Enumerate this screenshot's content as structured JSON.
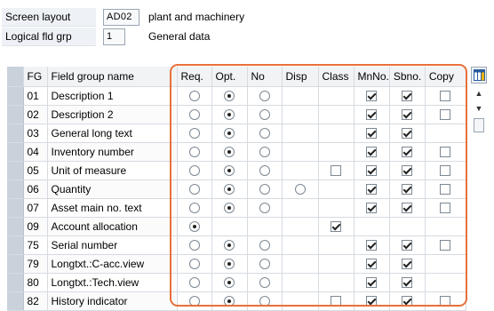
{
  "header": {
    "screen_layout_label": "Screen layout",
    "screen_layout_value": "AD02",
    "screen_layout_desc": "plant and machinery",
    "logical_fld_grp_label": "Logical fld grp",
    "logical_fld_grp_value": "1",
    "logical_fld_grp_desc": "General data"
  },
  "table": {
    "columns": [
      "",
      "FG",
      "Field group name",
      "Req.",
      "Opt.",
      "No",
      "Disp",
      "Class",
      "MnNo.",
      "Sbno.",
      "Copy"
    ],
    "rows": [
      {
        "fg": "01",
        "name": "Description 1",
        "sel": "opt",
        "disp": "none",
        "cls": "none",
        "mnno": true,
        "sbno": true,
        "copy": false
      },
      {
        "fg": "02",
        "name": "Description 2",
        "sel": "opt",
        "disp": "none",
        "cls": "none",
        "mnno": true,
        "sbno": true,
        "copy": false
      },
      {
        "fg": "03",
        "name": "General long text",
        "sel": "opt",
        "disp": "none",
        "cls": "none",
        "mnno": true,
        "sbno": true,
        "copy": null
      },
      {
        "fg": "04",
        "name": "Inventory number",
        "sel": "opt",
        "disp": "none",
        "cls": "none",
        "mnno": true,
        "sbno": true,
        "copy": false
      },
      {
        "fg": "05",
        "name": "Unit of measure",
        "sel": "opt",
        "disp": "none",
        "cls": "unchecked",
        "mnno": true,
        "sbno": true,
        "copy": false
      },
      {
        "fg": "06",
        "name": "Quantity",
        "sel": "opt",
        "disp": "radio",
        "cls": "none",
        "mnno": true,
        "sbno": true,
        "copy": false
      },
      {
        "fg": "07",
        "name": "Asset main no. text",
        "sel": "opt",
        "disp": "none",
        "cls": "none",
        "mnno": true,
        "sbno": true,
        "copy": false
      },
      {
        "fg": "09",
        "name": "Account allocation",
        "sel": "req",
        "disp": "none",
        "cls": "checked",
        "mnno": null,
        "sbno": null,
        "copy": null,
        "only_req": true
      },
      {
        "fg": "75",
        "name": "Serial number",
        "sel": "opt",
        "disp": "none",
        "cls": "none",
        "mnno": true,
        "sbno": true,
        "copy": false
      },
      {
        "fg": "79",
        "name": "Longtxt.:C-acc.view",
        "sel": "opt",
        "disp": "none",
        "cls": "none",
        "mnno": true,
        "sbno": true,
        "copy": null
      },
      {
        "fg": "80",
        "name": "Longtxt.:Tech.view",
        "sel": "opt",
        "disp": "none",
        "cls": "none",
        "mnno": true,
        "sbno": true,
        "copy": null
      },
      {
        "fg": "82",
        "name": "History indicator",
        "sel": "opt",
        "disp": "none",
        "cls": "unchecked",
        "mnno": true,
        "sbno": true,
        "copy": false
      }
    ]
  },
  "icons": {
    "settings": "table-settings-icon",
    "scroll_up": "scroll-up-icon",
    "scroll_down": "scroll-down-icon"
  },
  "colors": {
    "highlight": "#e8703a",
    "header_bg": "#f1f3f5",
    "selector_bg": "#c9d1da"
  }
}
